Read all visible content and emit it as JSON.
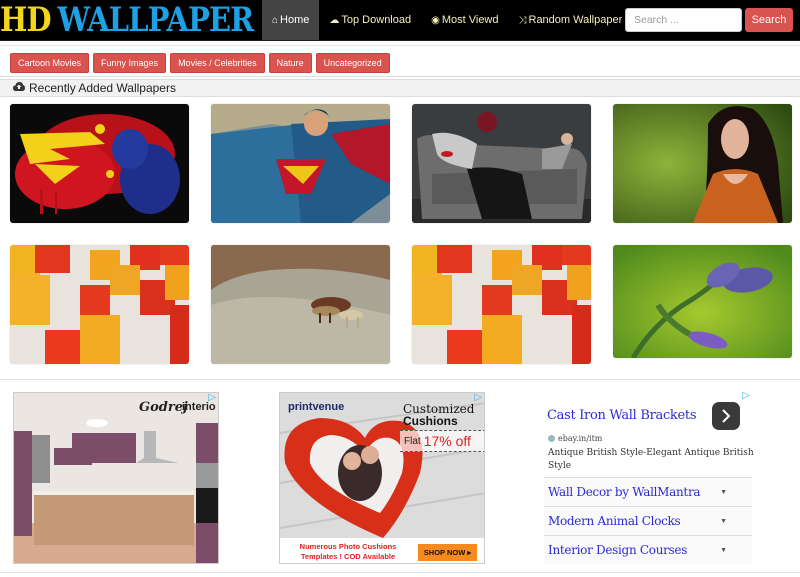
{
  "header": {
    "logo_part1": "HD",
    "logo_part2": "WALLPAPER",
    "nav": [
      {
        "icon": "home-icon",
        "glyph": "⌂",
        "label": "Home",
        "active": true
      },
      {
        "icon": "cloud-download-icon",
        "glyph": "☁",
        "label": "Top Download",
        "active": false
      },
      {
        "icon": "eye-icon",
        "glyph": "◉",
        "label": " Most Viewd",
        "active": false
      },
      {
        "icon": "random-icon",
        "glyph": "⤨",
        "label": "Random Wallpaper",
        "active": false
      }
    ],
    "search_placeholder": "Search ...",
    "search_value": "",
    "search_button": "Search"
  },
  "categories": [
    "Cartoon Movies",
    "Funny Images",
    "Movies / Celebrities",
    "Nature",
    "Uncategorized"
  ],
  "section": {
    "icon": "cloud-upload-icon",
    "title": "Recently Added Wallpapers"
  },
  "wallpapers": [
    {
      "subject": "superman-logo-paint-splatter"
    },
    {
      "subject": "superman-comic-art"
    },
    {
      "subject": "woman-on-sofa"
    },
    {
      "subject": "woman-in-orange-dress"
    },
    {
      "subject": "3d-cubes-red-orange"
    },
    {
      "subject": "horses-in-desert"
    },
    {
      "subject": "3d-cubes-red-orange"
    },
    {
      "subject": "purple-flower-buds"
    }
  ],
  "ads": {
    "ad1": {
      "brand": "Godrej interio"
    },
    "ad2": {
      "brand": "printvenue",
      "headline1": "Customized",
      "headline2": "Cushions",
      "offer_prefix": "Flat",
      "offer": "17% off",
      "footer1": "Numerous Photo Cushions",
      "footer2": "Templates ! COD Available",
      "cta": "SHOP NOW ▸"
    },
    "text_ad": {
      "title": "Cast Iron Wall Brackets",
      "url": "ebay.in/itm",
      "description": "Antique British Style-Elegant Antique British Style",
      "links": [
        "Wall Decor by WallMantra",
        "Modern Animal Clocks",
        "Interior Design Courses"
      ]
    },
    "ad_choices_glyph": "▷"
  },
  "colors": {
    "accent_red": "#d9534f",
    "logo_yellow": "#f2d61a",
    "logo_blue": "#1ea1e4",
    "ad_link_blue": "#2a2ad6"
  }
}
